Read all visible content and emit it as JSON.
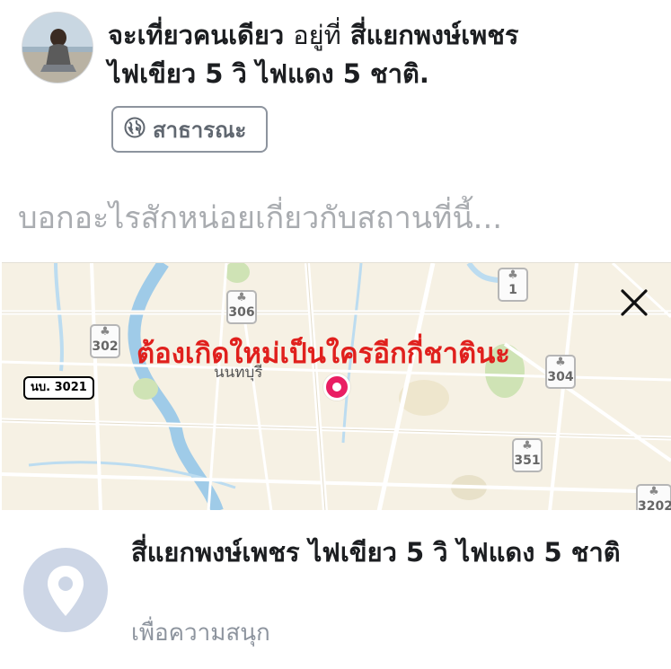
{
  "post": {
    "author_activity": "จะเที่ยวคนเดียว",
    "at_word": "อยู่ที่",
    "location_inline": "สี่แยกพงษ์เพชร",
    "location_inline_rest": "ไฟเขียว 5 วิ ไฟแดง 5 ชาติ."
  },
  "privacy": {
    "label": "สาธารณะ",
    "icon": "globe-icon"
  },
  "composer": {
    "placeholder": "บอกอะไรสักหน่อยเกี่ยวกับสถานที่นี้..."
  },
  "map": {
    "caption": "ต้องเกิดใหม่เป็นใครอีกกี่ชาตินะ",
    "city_label": "นนทบุรี",
    "road_plate": "นบ. 3021",
    "road_badges": [
      "306",
      "302",
      "1",
      "304",
      "351",
      "3202"
    ],
    "close_icon": "close-icon",
    "pin_icon": "map-pin-marker",
    "colors": {
      "land": "#f6f1e4",
      "water": "#9fcbe8",
      "park": "#cfe3b5",
      "pin": "#e91e63"
    }
  },
  "place": {
    "name": "สี่แยกพงษ์เพชร ไฟเขียว 5 วิ ไฟแดง 5 ชาติ",
    "category": "เพื่อความสนุก",
    "icon": "location-pin-icon"
  }
}
